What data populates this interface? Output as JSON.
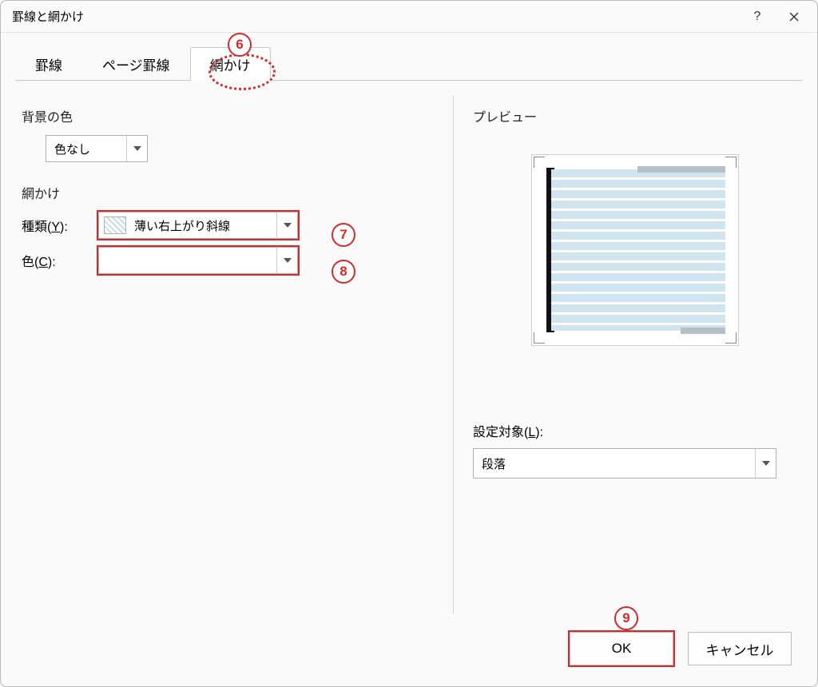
{
  "title": "罫線と網かけ",
  "tabs": {
    "borders": "罫線",
    "page_borders": "ページ罫線",
    "shading": "網かけ"
  },
  "bg": {
    "section": "背景の色",
    "value": "色なし"
  },
  "shading": {
    "section": "網かけ",
    "type_label": "種類(Y):",
    "type_value": "薄い右上がり斜線",
    "color_label": "色(C):"
  },
  "preview": {
    "section": "プレビュー"
  },
  "apply": {
    "label": "設定対象(L):",
    "value": "段落"
  },
  "buttons": {
    "ok": "OK",
    "cancel": "キャンセル"
  },
  "callouts": {
    "six": "6",
    "seven": "7",
    "eight": "8",
    "nine": "9"
  }
}
